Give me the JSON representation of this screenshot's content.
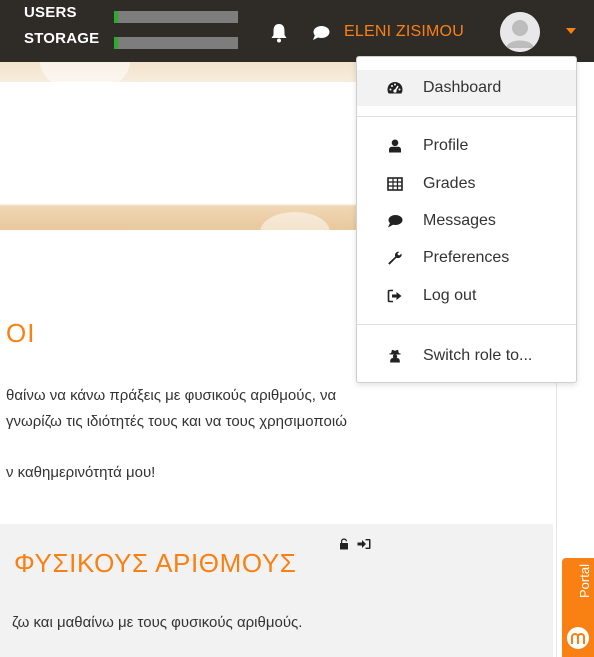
{
  "header": {
    "users_label": "USERS",
    "storage_label": "STORAGE",
    "users_level": 0.02,
    "storage_level": 0.02,
    "username": "ELENI ZISIMOU",
    "accent_color": "#f98012",
    "navbar_color": "#2f2b27",
    "icons": [
      "bell-icon",
      "chat-icon",
      "avatar",
      "caret-down-icon"
    ]
  },
  "user_menu": {
    "items": [
      {
        "label": "Dashboard",
        "icon": "dashboard-icon"
      },
      {
        "label": "Profile",
        "icon": "user-icon"
      },
      {
        "label": "Grades",
        "icon": "table-icon"
      },
      {
        "label": "Messages",
        "icon": "chat-icon"
      },
      {
        "label": "Preferences",
        "icon": "wrench-icon"
      },
      {
        "label": "Log out",
        "icon": "sign-out-icon"
      },
      {
        "label": "Switch role to...",
        "icon": "user-secret-icon"
      }
    ]
  },
  "content": {
    "heading_fragment": "ΟΙ",
    "para_line1": "θαίνω να κάνω πράξεις με φυσικούς αριθμούς, να",
    "para_line2": "γνωρίζω τις ιδιότητές τους και να τους χρησιμοποιώ",
    "para_line3": "ν καθημερινότητά μου!",
    "section_title": "ΦΥΣΙΚΟΥΣ ΑΡΙΘΜΟΥΣ",
    "section_text": "ζω και μαθαίνω με τους φυσικούς αριθμούς."
  },
  "portal": {
    "label": "Portal"
  }
}
